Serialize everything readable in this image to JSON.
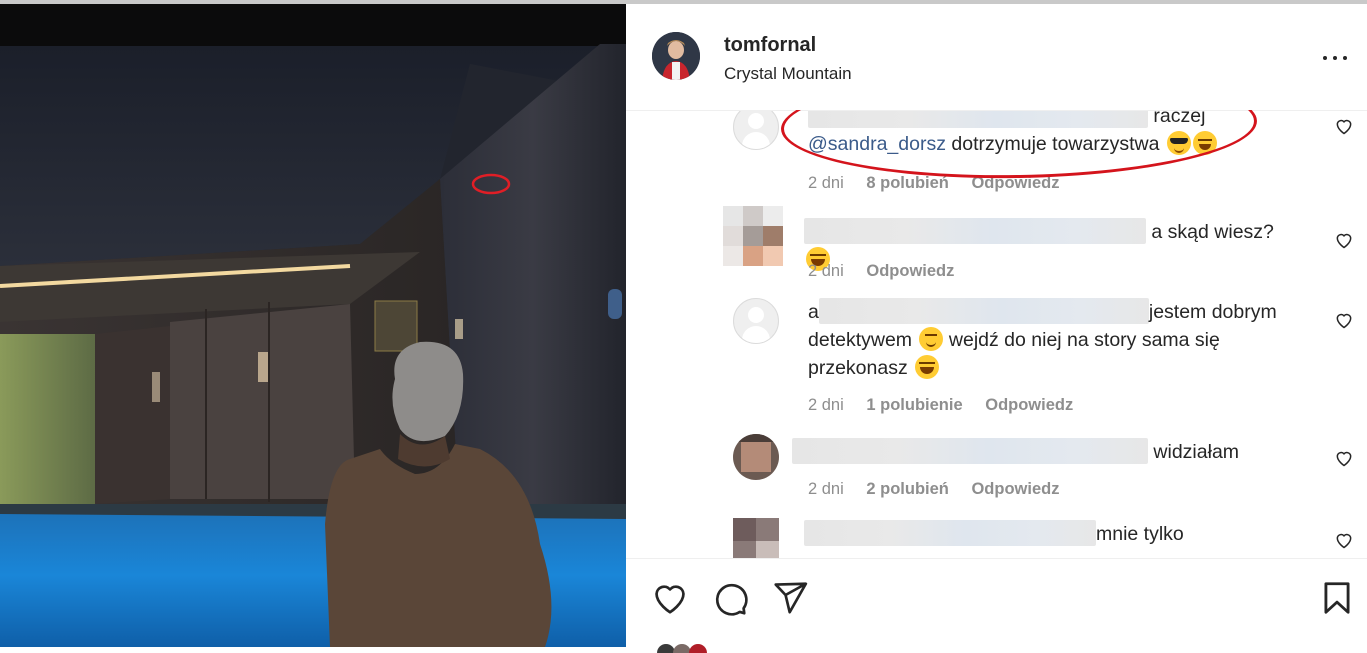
{
  "post": {
    "username": "tomfornal",
    "location": "Crystal Mountain"
  },
  "comments": [
    {
      "text_after": "raczej",
      "mention": "@sandra_dorsz",
      "text_line2": "dotrzymuje towarzystwa",
      "emojis": [
        "smiling-face-with-sunglasses",
        "grinning-face-with-sweat"
      ],
      "time": "2 dni",
      "likes": "8 polubień",
      "reply": "Odpowiedz"
    },
    {
      "text_after": "a skąd wiesz?",
      "emojis": [
        "face-with-tears-of-joy"
      ],
      "time": "2 dni",
      "reply": "Odpowiedz"
    },
    {
      "text_prefix": "a",
      "text_after": "jestem dobrym",
      "text_line2": "detektywem",
      "text_line2b": "wejdź do niej na story sama się",
      "text_line3": "przekonasz",
      "emojis": [
        "smirking-face",
        "face-with-tears-of-joy"
      ],
      "time": "2 dni",
      "likes": "1 polubienie",
      "reply": "Odpowiedz"
    },
    {
      "text_after": "widziałam",
      "time": "2 dni",
      "likes": "2 polubień",
      "reply": "Odpowiedz"
    },
    {
      "text_after": "mnie tylko"
    }
  ],
  "icons": {
    "more": "more-options-icon",
    "like": "heart-icon",
    "comment": "comment-icon",
    "share": "share-icon",
    "save": "bookmark-icon"
  },
  "colors": {
    "annotation_red": "#d4141c",
    "mention_blue": "#3b5b8a",
    "meta_gray": "#8e8e8e"
  }
}
